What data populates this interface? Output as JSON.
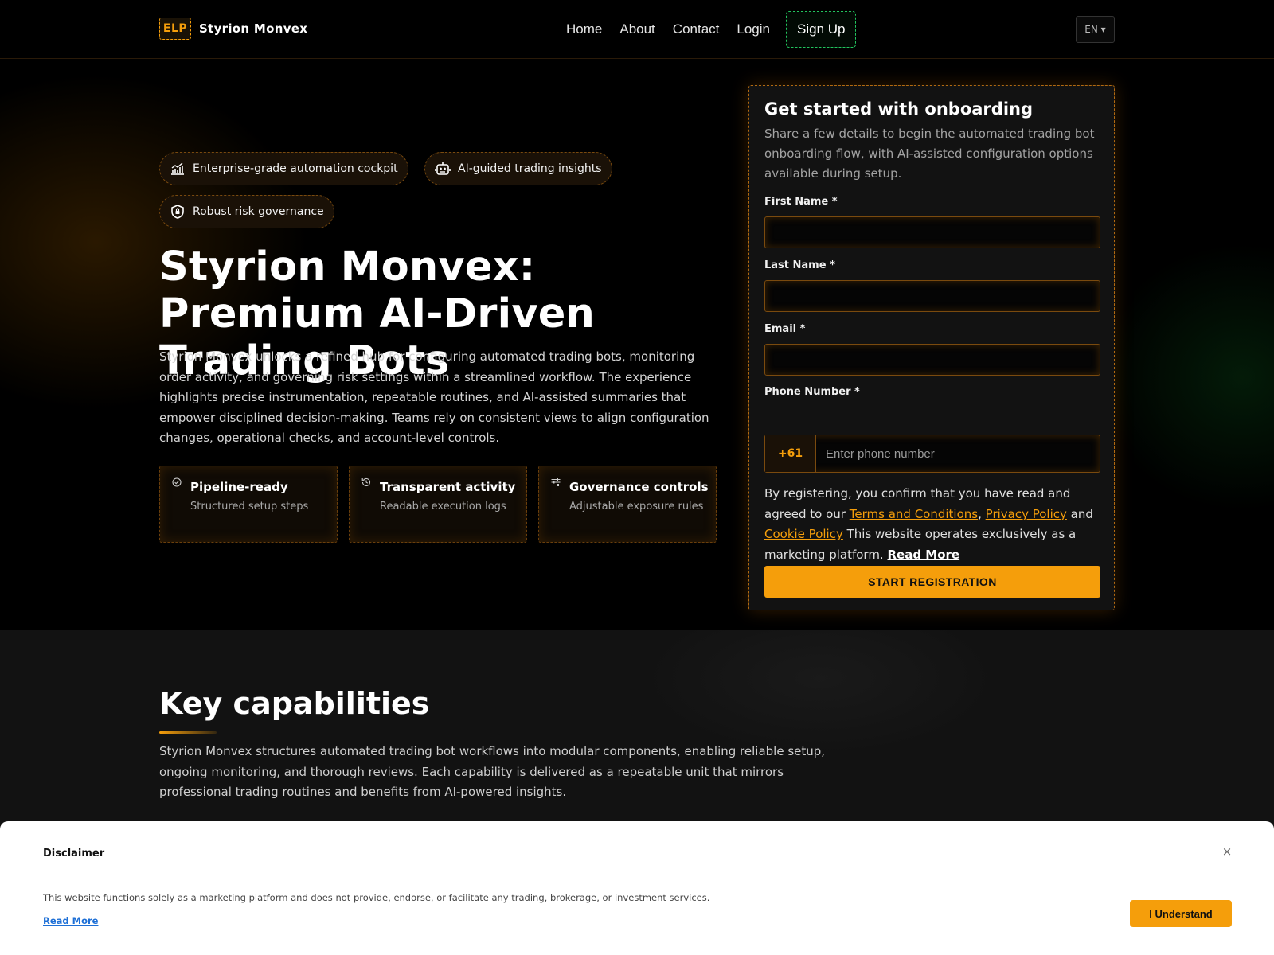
{
  "header": {
    "logo_text": "ELP",
    "brand_name": "Styrion Monvex",
    "nav": [
      "Home",
      "About",
      "Contact",
      "Login"
    ],
    "signup_label": "Sign Up",
    "language": "EN ▾"
  },
  "hero": {
    "chips": [
      {
        "icon": "chart-growth-icon",
        "label": "Enterprise-grade automation cockpit"
      },
      {
        "icon": "robot-icon",
        "label": "AI-guided trading insights"
      },
      {
        "icon": "shield-lock-icon",
        "label": "Robust risk governance"
      }
    ],
    "title": "Styrion Monvex: Premium AI-Driven Trading Bots",
    "description": "Styrion Monvex unlocks a refined hub for configuring automated trading bots, monitoring order activity, and governing risk settings within a streamlined workflow. The experience highlights precise instrumentation, repeatable routines, and AI-assisted summaries that empower disciplined decision-making. Teams rely on consistent views to align configuration changes, operational checks, and account-level controls.",
    "features": [
      {
        "icon": "check-circle-icon",
        "title": "Pipeline-ready",
        "subtitle": "Structured setup steps"
      },
      {
        "icon": "history-icon",
        "title": "Transparent activity",
        "subtitle": "Readable execution logs"
      },
      {
        "icon": "sliders-icon",
        "title": "Governance controls",
        "subtitle": "Adjustable exposure rules"
      }
    ]
  },
  "form": {
    "title": "Get started with onboarding",
    "description": "Share a few details to begin the automated trading bot onboarding flow, with AI-assisted configuration options available during setup.",
    "first_name_label": "First Name *",
    "last_name_label": "Last Name *",
    "email_label": "Email *",
    "phone_label": "Phone Number *",
    "country_code": "+61",
    "phone_placeholder": "Enter phone number",
    "consent_prefix": "By registering, you confirm that you have read and agreed to our",
    "terms_link": "Terms and Conditions",
    "comma": ",",
    "privacy_link": "Privacy Policy",
    "and_text": "and",
    "cookie_link": "Cookie Policy",
    "consent_suffix": "This website operates exclusively as a marketing platform.",
    "read_more": "Read More",
    "submit_label": "START REGISTRATION"
  },
  "capabilities": {
    "title": "Key capabilities",
    "description": "Styrion Monvex structures automated trading bot workflows into modular components, enabling reliable setup, ongoing monitoring, and thorough reviews. Each capability is delivered as a repeatable unit that mirrors professional trading routines and benefits from AI-powered insights."
  },
  "disclaimer": {
    "title": "Disclaimer",
    "close": "×",
    "text": "This website functions solely as a marketing platform and does not provide, endorse, or facilitate any trading, brokerage, or investment services.",
    "read_more": "Read More",
    "button_label": "I Understand"
  },
  "colors": {
    "accent": "#f59e0b",
    "background": "#000000",
    "section_bg": "#121212",
    "signup_border": "#22c55e",
    "link_blue": "#1d6fd6"
  }
}
